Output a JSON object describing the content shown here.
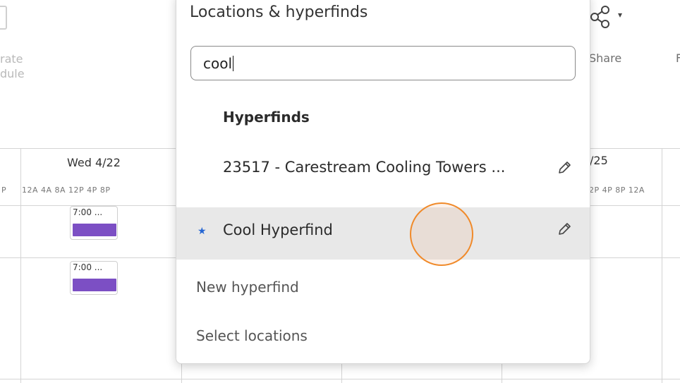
{
  "toolbar": {
    "left_faded_line1": "rate",
    "left_faded_line2": "dule",
    "share_label": "Share",
    "next_label": "F"
  },
  "calendar": {
    "day_left": "Wed 4/22",
    "day_right_partial": "/25",
    "hours_left": "12A  4A  8A  12P  4P  8P",
    "hours_edge": "P",
    "hours_right": "2P  4P  8P  12A",
    "events": [
      {
        "time": "7:00 ..."
      },
      {
        "time": "7:00 ..."
      }
    ]
  },
  "popover": {
    "title": "Locations & hyperfinds",
    "search": {
      "value": "cool",
      "placeholder": ""
    },
    "section_header": "Hyperfinds",
    "items": [
      {
        "label": "23517 - Carestream Cooling Towers ...",
        "favorite": false,
        "selected": false
      },
      {
        "label": "Cool Hyperfind",
        "favorite": true,
        "selected": true
      }
    ],
    "actions": [
      {
        "label": "New hyperfind"
      },
      {
        "label": "Select locations"
      }
    ]
  },
  "colors": {
    "accent_event": "#7c4fc4",
    "star": "#2566d3",
    "click_indicator": "#f08a2a",
    "selected_row": "#e8e8e8"
  },
  "icons": {
    "share": "share-icon",
    "edit": "pencil-icon",
    "favorite": "star-icon"
  }
}
